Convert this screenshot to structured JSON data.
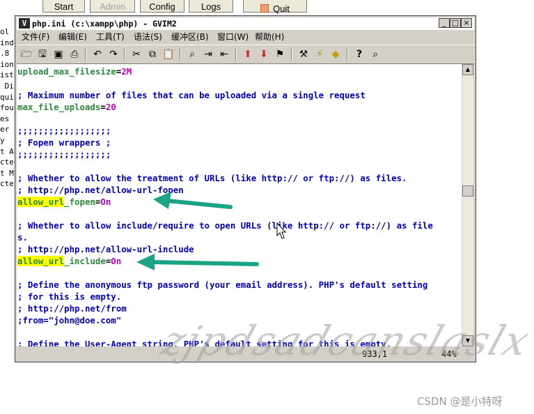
{
  "xampp_buttons": [
    {
      "label": "Start",
      "disabled": false
    },
    {
      "label": "Admin",
      "disabled": true
    },
    {
      "label": "Config",
      "disabled": false
    },
    {
      "label": "Logs",
      "disabled": false
    },
    {
      "label": "Quit",
      "disabled": false
    }
  ],
  "background_text": [
    "ol",
    "ind",
    ".8",
    "ion",
    "ist",
    " Di",
    "qui",
    "fou",
    "es",
    "er",
    "y",
    "t A",
    "cte",
    "t M",
    "cte"
  ],
  "window": {
    "title": "php.ini (c:\\xampp\\php) - GVIM2",
    "controls": {
      "minimize": "_",
      "maximize": "□",
      "close": "×"
    }
  },
  "menu": [
    "文件(F)",
    "编辑(E)",
    "工具(T)",
    "语法(S)",
    "缓冲区(B)",
    "窗口(W)",
    "帮助(H)"
  ],
  "toolbar": [
    "open-icon",
    "save-icon",
    "save-all-icon",
    "print-icon",
    "undo-icon",
    "redo-icon",
    "cut-icon",
    "copy-icon",
    "paste-icon",
    "find-replace-icon",
    "find-next-icon",
    "find-prev-icon",
    "load-session-icon",
    "save-session-icon",
    "run-script-icon",
    "make-icon",
    "shell-icon",
    "find-tag-icon",
    "help-icon",
    "find-help-icon"
  ],
  "editor_lines": [
    {
      "kind": "setting",
      "key": "upload_max_filesize",
      "value": "2M"
    },
    {
      "kind": "blank"
    },
    {
      "kind": "comment",
      "text": "; Maximum number of files that can be uploaded via a single request"
    },
    {
      "kind": "setting",
      "key": "max_file_uploads",
      "value": "20"
    },
    {
      "kind": "blank"
    },
    {
      "kind": "comment",
      "text": ";;;;;;;;;;;;;;;;;;"
    },
    {
      "kind": "comment",
      "text": "; Fopen wrappers ;"
    },
    {
      "kind": "comment",
      "text": ";;;;;;;;;;;;;;;;;;"
    },
    {
      "kind": "blank"
    },
    {
      "kind": "comment",
      "text": "; Whether to allow the treatment of URLs (like http:// or ftp://) as files."
    },
    {
      "kind": "comment",
      "text": "; http://php.net/allow-url-fopen"
    },
    {
      "kind": "setting_hl",
      "hl": "allow_url",
      "key": "_fopen",
      "value": "On"
    },
    {
      "kind": "blank"
    },
    {
      "kind": "comment",
      "text": "; Whether to allow include/require to open URLs (like http:// or ftp://) as file"
    },
    {
      "kind": "comment",
      "text": "s."
    },
    {
      "kind": "comment",
      "text": "; http://php.net/allow-url-include"
    },
    {
      "kind": "setting_hl",
      "hl": "allow_url",
      "key": "_include",
      "value": "On"
    },
    {
      "kind": "blank"
    },
    {
      "kind": "comment",
      "text": "; Define the anonymous ftp password (your email address). PHP's default setting"
    },
    {
      "kind": "comment",
      "text": "; for this is empty."
    },
    {
      "kind": "comment",
      "text": "; http://php.net/from"
    },
    {
      "kind": "plain",
      "text": ";from=\"john@doe.com\""
    },
    {
      "kind": "blank"
    },
    {
      "kind": "comment",
      "text": "; Define the User-Agent string. PHP's default setting for this is empty."
    }
  ],
  "status": {
    "position": "933,1",
    "percent": "44%"
  },
  "watermark": "zjpdsadcanslaslx",
  "csdn": "CSDN @是小特呀"
}
